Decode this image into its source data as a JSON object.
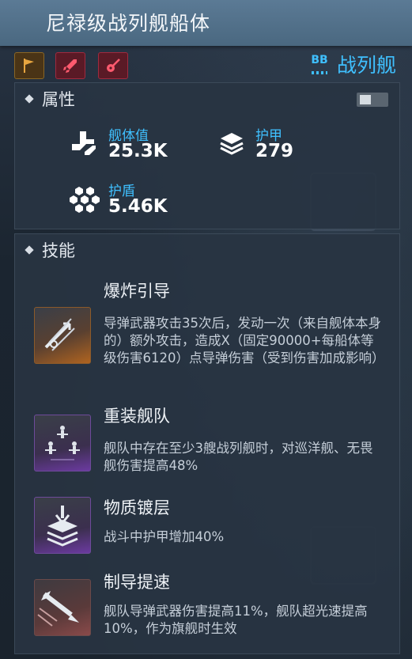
{
  "header": {
    "title": "尼禄级战列舰船体"
  },
  "tags": [
    {
      "icon": "flag-icon",
      "color": "#8a6624"
    },
    {
      "icon": "rocket-icon",
      "color": "#a02a3e"
    },
    {
      "icon": "guitar-icon",
      "color": "#a02a3e"
    }
  ],
  "ship_class": {
    "icon_text": "BB",
    "label": "战列舰",
    "color": "#3fc0ff"
  },
  "attributes": {
    "title": "属性",
    "toggle_on": false,
    "stats": [
      {
        "icon": "hull-icon",
        "label": "舰体值",
        "value": "25.3K"
      },
      {
        "icon": "armor-icon",
        "label": "护甲",
        "value": "279"
      },
      {
        "icon": "shield-icon",
        "label": "护盾",
        "value": "5.46K"
      }
    ]
  },
  "skills": {
    "title": "技能",
    "items": [
      {
        "icon": "missile-burst-icon",
        "name": "爆炸引导",
        "description": "导弹武器攻击35次后，发动一次（来自舰体本身的）额外攻击，造成X（固定90000+每船体等级伤害6120）点导弹伤害（受到伤害加成影响）"
      },
      {
        "icon": "fleet-formation-icon",
        "name": "重装舰队",
        "description": "舰队中存在至少3艘战列舰时，对巡洋舰、无畏舰伤害提高48%"
      },
      {
        "icon": "armor-plating-icon",
        "name": "物质镀层",
        "description": "战斗中护甲增加40%"
      },
      {
        "icon": "missile-speed-icon",
        "name": "制导提速",
        "description": "舰队导弹武器伤害提高11%，舰队超光速提高10%，作为旗舰时生效"
      }
    ]
  }
}
